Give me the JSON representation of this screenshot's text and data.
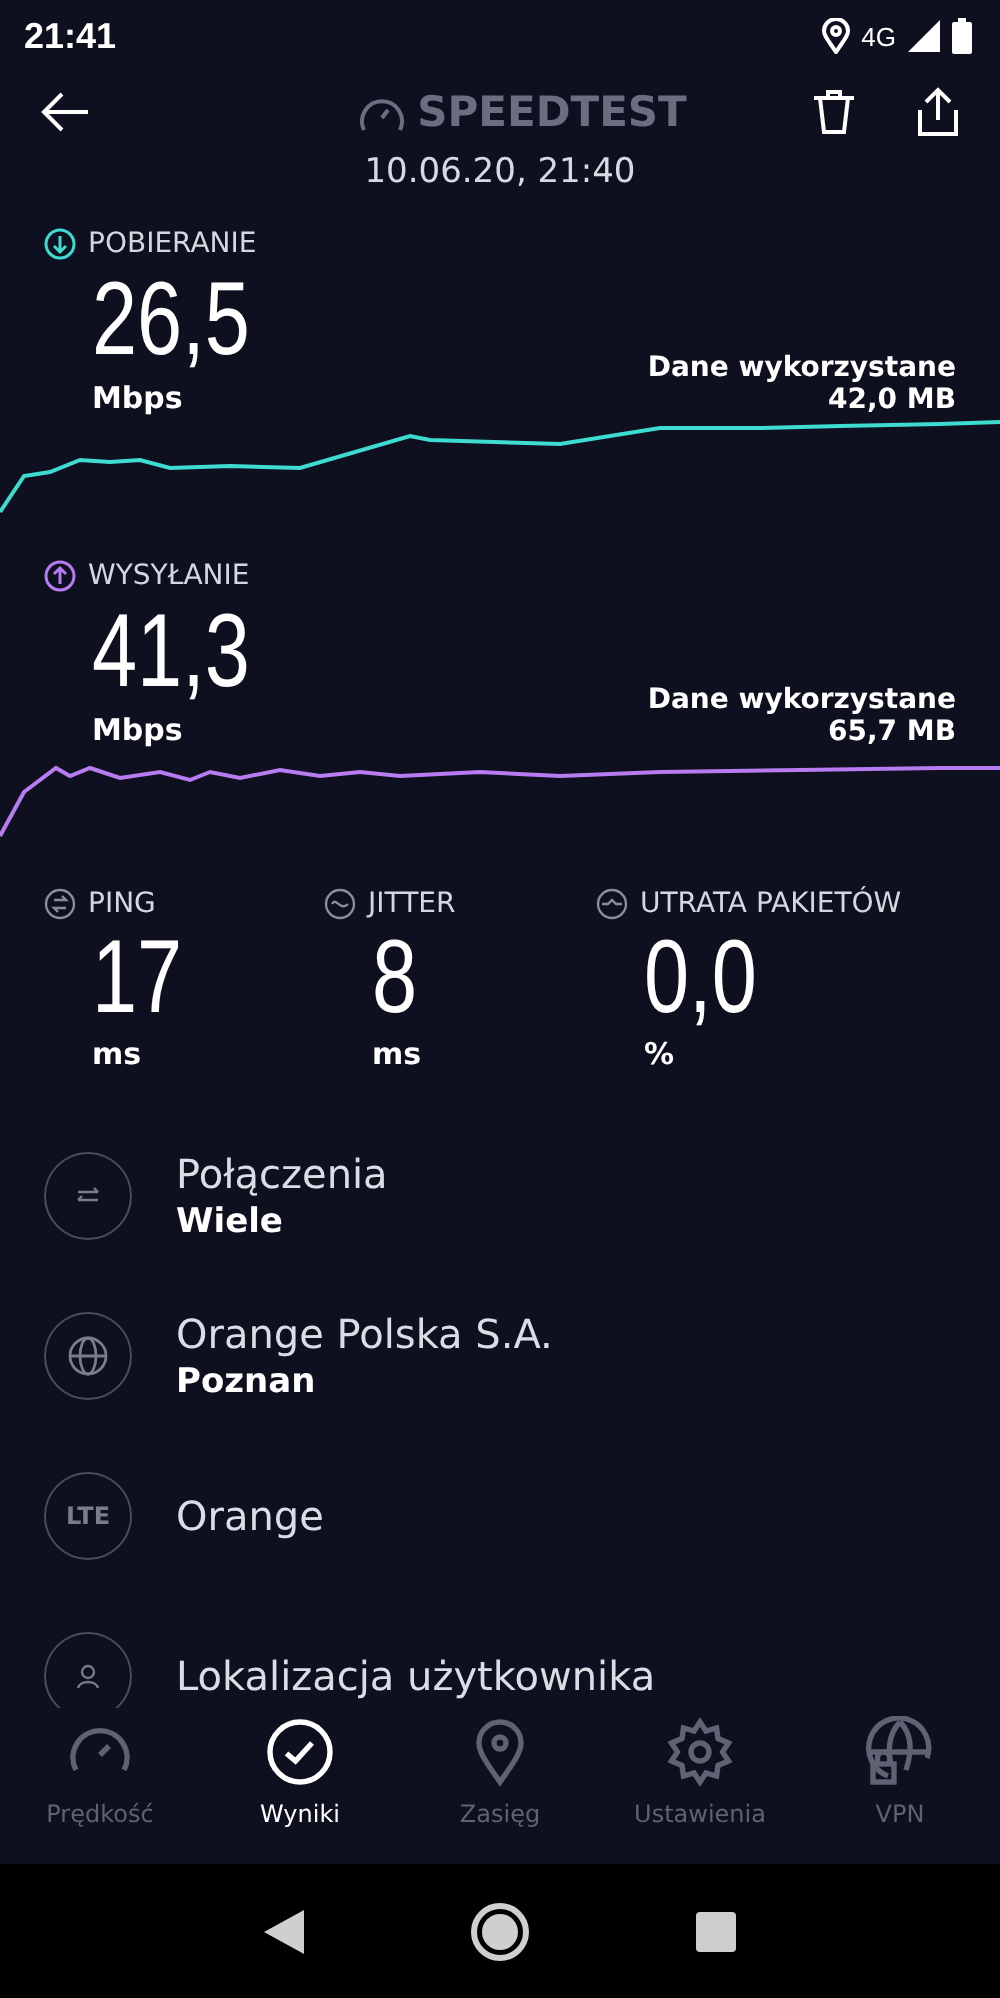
{
  "status_bar": {
    "time": "21:41",
    "network": "4G"
  },
  "header": {
    "title": "SPEEDTEST",
    "date": "10.06.20, 21:40"
  },
  "speeds": [
    {
      "kind": "download",
      "label": "POBIERANIE",
      "value": "26,5",
      "unit": "Mbps",
      "data_label": "Dane wykorzystane",
      "data_value": "42,0 MB",
      "color": "#3ddbd0"
    },
    {
      "kind": "upload",
      "label": "WYSYŁANIE",
      "value": "41,3",
      "unit": "Mbps",
      "data_label": "Dane wykorzystane",
      "data_value": "65,7 MB",
      "color": "#b77cf2"
    }
  ],
  "metrics": [
    {
      "kind": "ping",
      "label": "PING",
      "value": "17",
      "unit": "ms"
    },
    {
      "kind": "jitter",
      "label": "JITTER",
      "value": "8",
      "unit": "ms"
    },
    {
      "kind": "loss",
      "label": "UTRATA PAKIETÓW",
      "value": "0,0",
      "unit": "%"
    }
  ],
  "details": [
    {
      "kind": "connections",
      "title": "Połączenia",
      "subtitle": "Wiele"
    },
    {
      "kind": "globe",
      "title": "Orange Polska S.A.",
      "subtitle": "Poznan"
    },
    {
      "kind": "lte",
      "badge": "LTE",
      "title": "Orange"
    },
    {
      "kind": "location",
      "title": "Lokalizacja użytkownika"
    }
  ],
  "nav": [
    {
      "kind": "speed",
      "label": "Prędkość",
      "selected": false
    },
    {
      "kind": "results",
      "label": "Wyniki",
      "selected": true
    },
    {
      "kind": "coverage",
      "label": "Zasięg",
      "selected": false
    },
    {
      "kind": "settings",
      "label": "Ustawienia",
      "selected": false
    },
    {
      "kind": "vpn",
      "label": "VPN",
      "selected": false
    }
  ]
}
